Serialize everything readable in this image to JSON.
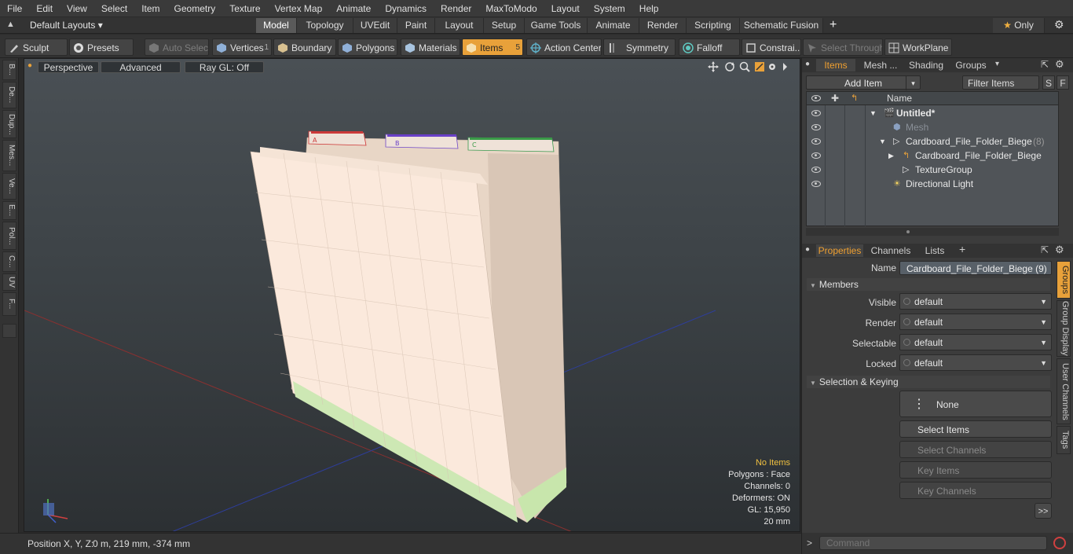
{
  "menu": [
    "File",
    "Edit",
    "View",
    "Select",
    "Item",
    "Geometry",
    "Texture",
    "Vertex Map",
    "Animate",
    "Dynamics",
    "Render",
    "MaxToModo",
    "Layout",
    "System",
    "Help"
  ],
  "layout_selector": "Default Layouts",
  "top_tabs": [
    "Model",
    "Topology",
    "UVEdit",
    "Paint",
    "Layout",
    "Setup",
    "Game Tools",
    "Animate",
    "Render",
    "Scripting",
    "Schematic Fusion"
  ],
  "active_top_tab": "Model",
  "only_label": "Only",
  "toolbar": {
    "sculpt": "Sculpt",
    "presets": "Presets",
    "auto_select": "Auto Select",
    "vertices": "Vertices",
    "vertices_count": "1",
    "boundary": "Boundary",
    "polygons": "Polygons",
    "materials": "Materials",
    "items": "Items",
    "items_count": "5",
    "action_center": "Action Center",
    "symmetry": "Symmetry",
    "falloff": "Falloff",
    "constraints": "Constrai...",
    "select_through": "Select Through",
    "workplane": "WorkPlane"
  },
  "left_tabs": [
    "B...",
    "De...",
    "Dup...",
    "Mes...",
    "Ve...",
    "E...",
    "Pol...",
    "C...",
    "UV",
    "F..."
  ],
  "viewport": {
    "perspective": "Perspective",
    "advanced": "Advanced",
    "raygl": "Ray GL: Off",
    "tabs": [
      "A",
      "B",
      "C"
    ],
    "hud": {
      "no_items": "No Items",
      "polygons": "Polygons : Face",
      "channels": "Channels: 0",
      "deformers": "Deformers: ON",
      "gl": "GL: 15,950",
      "unit": "20 mm"
    }
  },
  "status": {
    "position_label": "Position X, Y, Z:",
    "position_value": "0 m, 219 mm, -374 mm"
  },
  "items_panel": {
    "tabs": [
      "Items",
      "Mesh ...",
      "Shading",
      "Groups"
    ],
    "add_item": "Add Item",
    "filter_items": "Filter Items",
    "s_btn": "S",
    "f_btn": "F",
    "name_header": "Name",
    "tree": [
      {
        "name": "Untitled*",
        "bold": true
      },
      {
        "name": "Mesh",
        "dim": true
      },
      {
        "name": "Cardboard_File_Folder_Biege",
        "count": "(8)"
      },
      {
        "name": "Cardboard_File_Folder_Biege"
      },
      {
        "name": "TextureGroup"
      },
      {
        "name": "Directional Light"
      }
    ]
  },
  "properties_panel": {
    "tabs": [
      "Properties",
      "Channels",
      "Lists"
    ],
    "name_label": "Name",
    "name_value": "Cardboard_File_Folder_Biege (9)",
    "members_section": "Members",
    "members": [
      {
        "label": "Visible",
        "value": "default"
      },
      {
        "label": "Render",
        "value": "default"
      },
      {
        "label": "Selectable",
        "value": "default"
      },
      {
        "label": "Locked",
        "value": "default"
      }
    ],
    "selection_section": "Selection & Keying",
    "none_btn": "None",
    "select_items": "Select Items",
    "select_channels": "Select Channels",
    "key_items": "Key Items",
    "key_channels": "Key Channels",
    "more": ">>",
    "side_tabs": [
      "Groups",
      "Group Display",
      "User Channels",
      "Tags"
    ]
  },
  "command_placeholder": "Command"
}
